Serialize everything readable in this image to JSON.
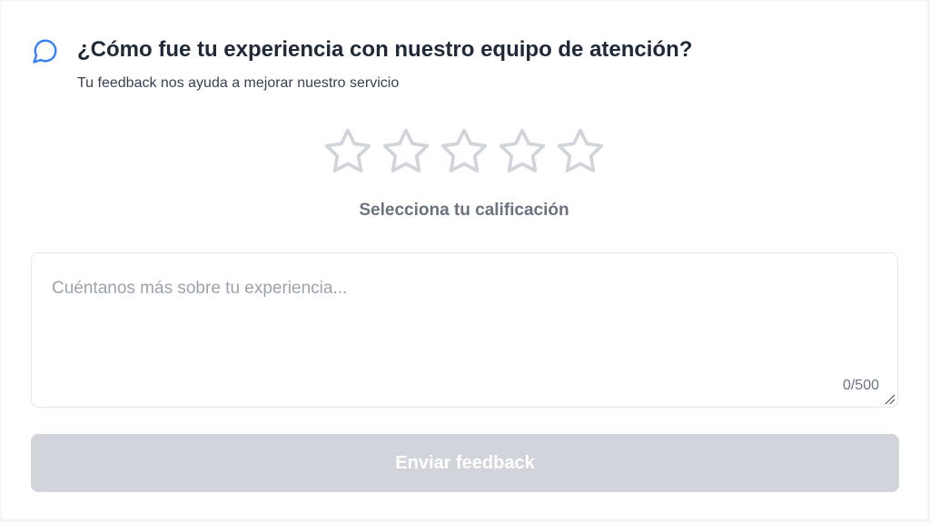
{
  "header": {
    "icon": "chat-bubble-icon",
    "title": "¿Cómo fue tu experiencia con nuestro equipo de atención?",
    "subtitle": "Tu feedback nos ayuda a mejorar nuestro servicio"
  },
  "rating": {
    "stars_total": 5,
    "stars_selected": 0,
    "label": "Selecciona tu calificación",
    "star_icon": "star-outline-icon"
  },
  "comment": {
    "placeholder": "Cuéntanos más sobre tu experiencia...",
    "value": "",
    "counter": "0/500"
  },
  "submit": {
    "label": "Enviar feedback",
    "disabled": true
  },
  "colors": {
    "accent": "#3b82f6",
    "star_outline": "#d1d5db",
    "button_disabled": "#d1d5db"
  }
}
